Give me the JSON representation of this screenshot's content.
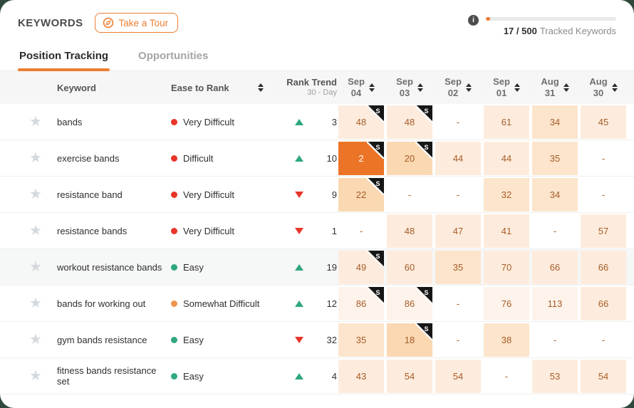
{
  "header": {
    "title": "KEYWORDS",
    "tour_button": "Take a Tour",
    "quota_used": "17 / 500",
    "quota_label": "Tracked Keywords",
    "quota_percent": 3.4
  },
  "tabs": [
    {
      "label": "Position Tracking",
      "active": true
    },
    {
      "label": "Opportunities",
      "active": false
    }
  ],
  "table": {
    "sponsored_badge": "S",
    "empty_value": "-",
    "columns": {
      "keyword": "Keyword",
      "ease": "Ease to Rank",
      "rank_trend": "Rank Trend",
      "rank_trend_sub": "30 - Day",
      "dates": [
        [
          "Sep",
          "04"
        ],
        [
          "Sep",
          "03"
        ],
        [
          "Sep",
          "02"
        ],
        [
          "Sep",
          "01"
        ],
        [
          "Aug",
          "31"
        ],
        [
          "Aug",
          "30"
        ]
      ]
    },
    "rows": [
      {
        "keyword": "bands",
        "ease": {
          "label": "Very Difficult",
          "color": "red"
        },
        "trend": {
          "direction": "up",
          "value": 3
        },
        "highlighted": false,
        "cells": [
          {
            "value": 48,
            "sponsored": true
          },
          {
            "value": 48,
            "sponsored": true
          },
          {
            "value": null
          },
          {
            "value": 61
          },
          {
            "value": 34
          },
          {
            "value": 45
          }
        ]
      },
      {
        "keyword": "exercise bands",
        "ease": {
          "label": "Difficult",
          "color": "red"
        },
        "trend": {
          "direction": "up",
          "value": 10
        },
        "highlighted": false,
        "cells": [
          {
            "value": 2,
            "sponsored": true
          },
          {
            "value": 20,
            "sponsored": true
          },
          {
            "value": 44
          },
          {
            "value": 44
          },
          {
            "value": 35
          },
          {
            "value": null
          }
        ]
      },
      {
        "keyword": "resistance band",
        "ease": {
          "label": "Very Difficult",
          "color": "red"
        },
        "trend": {
          "direction": "down",
          "value": 9
        },
        "highlighted": false,
        "cells": [
          {
            "value": 22,
            "sponsored": true
          },
          {
            "value": null
          },
          {
            "value": null
          },
          {
            "value": 32
          },
          {
            "value": 34
          },
          {
            "value": null
          }
        ]
      },
      {
        "keyword": "resistance bands",
        "ease": {
          "label": "Very Difficult",
          "color": "red"
        },
        "trend": {
          "direction": "down",
          "value": 1
        },
        "highlighted": false,
        "cells": [
          {
            "value": null
          },
          {
            "value": 48
          },
          {
            "value": 47
          },
          {
            "value": 41
          },
          {
            "value": null
          },
          {
            "value": 57
          }
        ]
      },
      {
        "keyword": "workout resistance bands",
        "ease": {
          "label": "Easy",
          "color": "green"
        },
        "trend": {
          "direction": "up",
          "value": 19
        },
        "highlighted": true,
        "cells": [
          {
            "value": 49,
            "sponsored": true
          },
          {
            "value": 60
          },
          {
            "value": 35
          },
          {
            "value": 70
          },
          {
            "value": 66
          },
          {
            "value": 66
          }
        ]
      },
      {
        "keyword": "bands for working out",
        "ease": {
          "label": "Somewhat Difficult",
          "color": "orange"
        },
        "trend": {
          "direction": "up",
          "value": 12
        },
        "highlighted": false,
        "cells": [
          {
            "value": 86,
            "sponsored": true
          },
          {
            "value": 86,
            "sponsored": true
          },
          {
            "value": null
          },
          {
            "value": 76
          },
          {
            "value": 113
          },
          {
            "value": 66
          }
        ]
      },
      {
        "keyword": "gym bands resistance",
        "ease": {
          "label": "Easy",
          "color": "green"
        },
        "trend": {
          "direction": "down",
          "value": 32
        },
        "highlighted": false,
        "cells": [
          {
            "value": 35
          },
          {
            "value": 18,
            "sponsored": true
          },
          {
            "value": null
          },
          {
            "value": 38
          },
          {
            "value": null
          },
          {
            "value": null
          }
        ]
      },
      {
        "keyword": "fitness bands resistance set",
        "ease": {
          "label": "Easy",
          "color": "green"
        },
        "trend": {
          "direction": "up",
          "value": 4
        },
        "highlighted": false,
        "cells": [
          {
            "value": 43
          },
          {
            "value": 54
          },
          {
            "value": 54
          },
          {
            "value": null
          },
          {
            "value": 53
          },
          {
            "value": 54
          }
        ]
      }
    ]
  },
  "colors": {
    "accent": "#ED7D31",
    "heat_deep": "#EC7426",
    "heat_med": "#FAD8B2",
    "heat_l2": "#FCE5CC",
    "heat_l1": "#FDECDD",
    "heat_l0": "#FDF3EA",
    "cell_text": "#A65C27",
    "ease_red": "#E8352A",
    "ease_orange": "#F0954D",
    "ease_green": "#2FA87C"
  }
}
